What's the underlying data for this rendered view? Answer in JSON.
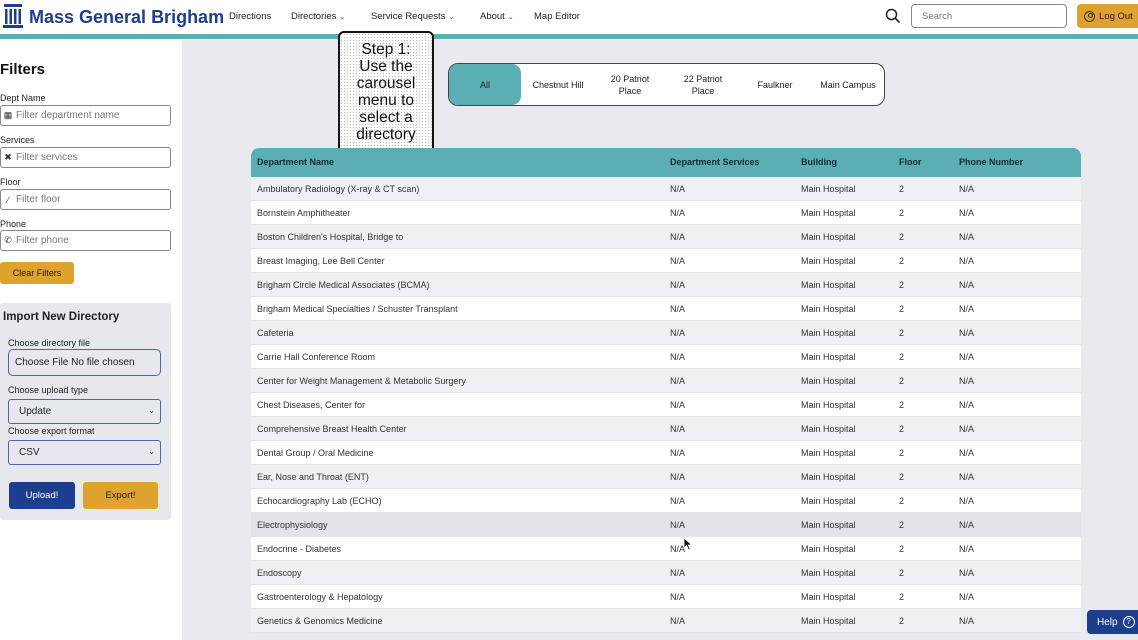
{
  "header": {
    "brand": "Mass General Brigham",
    "nav": [
      {
        "label": "Directions",
        "dropdown": false
      },
      {
        "label": "Directories",
        "dropdown": true
      },
      {
        "label": "Service Requests",
        "dropdown": true
      },
      {
        "label": "About",
        "dropdown": true
      },
      {
        "label": "Map Editor",
        "dropdown": false
      }
    ],
    "search_placeholder": "Search",
    "logout_label": "Log Out"
  },
  "filters": {
    "title": "Filters",
    "dept": {
      "label": "Dept Name",
      "placeholder": "Filter department name",
      "icon": "building-icon"
    },
    "services": {
      "label": "Services",
      "placeholder": "Filter services",
      "icon": "tools-icon"
    },
    "floor": {
      "label": "Floor",
      "placeholder": "Filter floor",
      "icon": "stairs-icon"
    },
    "phone": {
      "label": "Phone",
      "placeholder": "Filter phone",
      "icon": "phone-icon"
    },
    "clear_label": "Clear Filters"
  },
  "import": {
    "title": "Import New Directory",
    "file_label": "Choose directory file",
    "file_value": "Choose File No file chosen",
    "upload_type_label": "Choose upload type",
    "upload_type_value": "Update",
    "export_label": "Choose export format",
    "export_value": "CSV",
    "upload_btn": "Upload!",
    "export_btn": "Export!"
  },
  "callout": {
    "lines": [
      "Step 1:",
      "Use the",
      "carousel",
      "menu to",
      "select a",
      "directory"
    ]
  },
  "carousel": {
    "items": [
      {
        "label": "All",
        "active": true
      },
      {
        "label": "Chestnut Hill",
        "active": false
      },
      {
        "label": "20 Patriot Place",
        "active": false
      },
      {
        "label": "22 Patriot Place",
        "active": false
      },
      {
        "label": "Faulkner",
        "active": false
      },
      {
        "label": "Main Campus",
        "active": false
      }
    ]
  },
  "table": {
    "columns": [
      "Department Name",
      "Department Services",
      "Building",
      "Floor",
      "Phone Number"
    ],
    "rows": [
      [
        "Ambulatory Radiology (X-ray & CT scan)",
        "N/A",
        "Main Hospital",
        "2",
        "N/A"
      ],
      [
        "Bornstein Amphitheater",
        "N/A",
        "Main Hospital",
        "2",
        "N/A"
      ],
      [
        "Boston Children's Hospital, Bridge to",
        "N/A",
        "Main Hospital",
        "2",
        "N/A"
      ],
      [
        "Breast Imaging, Lee Bell Center",
        "N/A",
        "Main Hospital",
        "2",
        "N/A"
      ],
      [
        "Brigham Circle Medical Associates (BCMA)",
        "N/A",
        "Main Hospital",
        "2",
        "N/A"
      ],
      [
        "Brigham Medical Specialties / Schuster Transplant",
        "N/A",
        "Main Hospital",
        "2",
        "N/A"
      ],
      [
        "Cafeteria",
        "N/A",
        "Main Hospital",
        "2",
        "N/A"
      ],
      [
        "Carrie Hall Conference Room",
        "N/A",
        "Main Hospital",
        "2",
        "N/A"
      ],
      [
        "Center for Weight Management & Metabolic Surgery",
        "N/A",
        "Main Hospital",
        "2",
        "N/A"
      ],
      [
        "Chest Diseases, Center for",
        "N/A",
        "Main Hospital",
        "2",
        "N/A"
      ],
      [
        "Comprehensive Breast Health Center",
        "N/A",
        "Main Hospital",
        "2",
        "N/A"
      ],
      [
        "Dental Group / Oral Medicine",
        "N/A",
        "Main Hospital",
        "2",
        "N/A"
      ],
      [
        "Ear, Nose and Throat (ENT)",
        "N/A",
        "Main Hospital",
        "2",
        "N/A"
      ],
      [
        "Echocardiography Lab (ECHO)",
        "N/A",
        "Main Hospital",
        "2",
        "N/A"
      ],
      [
        "Electrophysiology",
        "N/A",
        "Main Hospital",
        "2",
        "N/A"
      ],
      [
        "Endocrine - Diabetes",
        "N/A",
        "Main Hospital",
        "2",
        "N/A"
      ],
      [
        "Endoscopy",
        "N/A",
        "Main Hospital",
        "2",
        "N/A"
      ],
      [
        "Gastroenterology & Hepatology",
        "N/A",
        "Main Hospital",
        "2",
        "N/A"
      ],
      [
        "Genetics & Genomics Medicine",
        "N/A",
        "Main Hospital",
        "2",
        "N/A"
      ]
    ],
    "hovered_row": 14
  },
  "help_label": "Help",
  "colors": {
    "brand": "#1d3d8f",
    "teal": "#5aaeb4",
    "gold": "#e0a22e"
  }
}
